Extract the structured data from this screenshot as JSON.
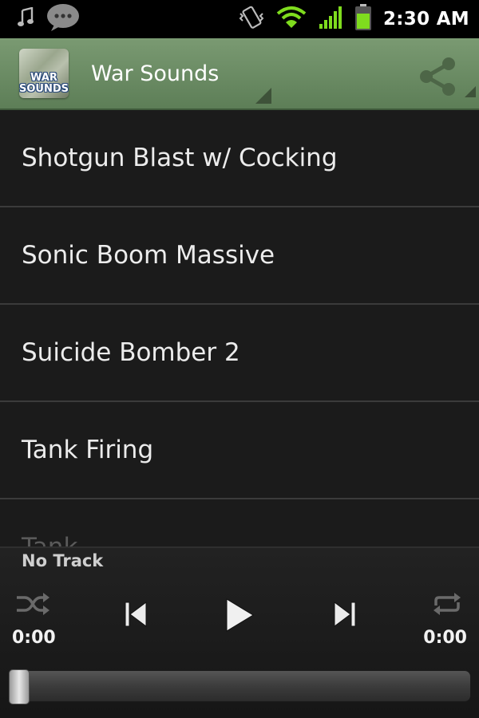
{
  "status_bar": {
    "time": "2:30 AM",
    "icons": [
      "music-note-icon",
      "chat-icon",
      "vibrate-icon",
      "wifi-icon",
      "signal-icon",
      "battery-icon"
    ]
  },
  "action_bar": {
    "app_icon_text": "WAR SOUNDS",
    "title": "War Sounds",
    "share_icon": "share-icon",
    "color": "#6b8c64"
  },
  "sounds": [
    {
      "label": "Shotgun Blast w/ Cocking"
    },
    {
      "label": "Sonic Boom Massive"
    },
    {
      "label": "Suicide Bomber 2"
    },
    {
      "label": "Tank Firing"
    },
    {
      "label": "Tank"
    }
  ],
  "player": {
    "track_name": "No Track",
    "elapsed": "0:00",
    "duration": "0:00",
    "progress": 0,
    "controls": [
      "shuffle-icon",
      "previous-icon",
      "play-icon",
      "next-icon",
      "repeat-icon"
    ]
  }
}
